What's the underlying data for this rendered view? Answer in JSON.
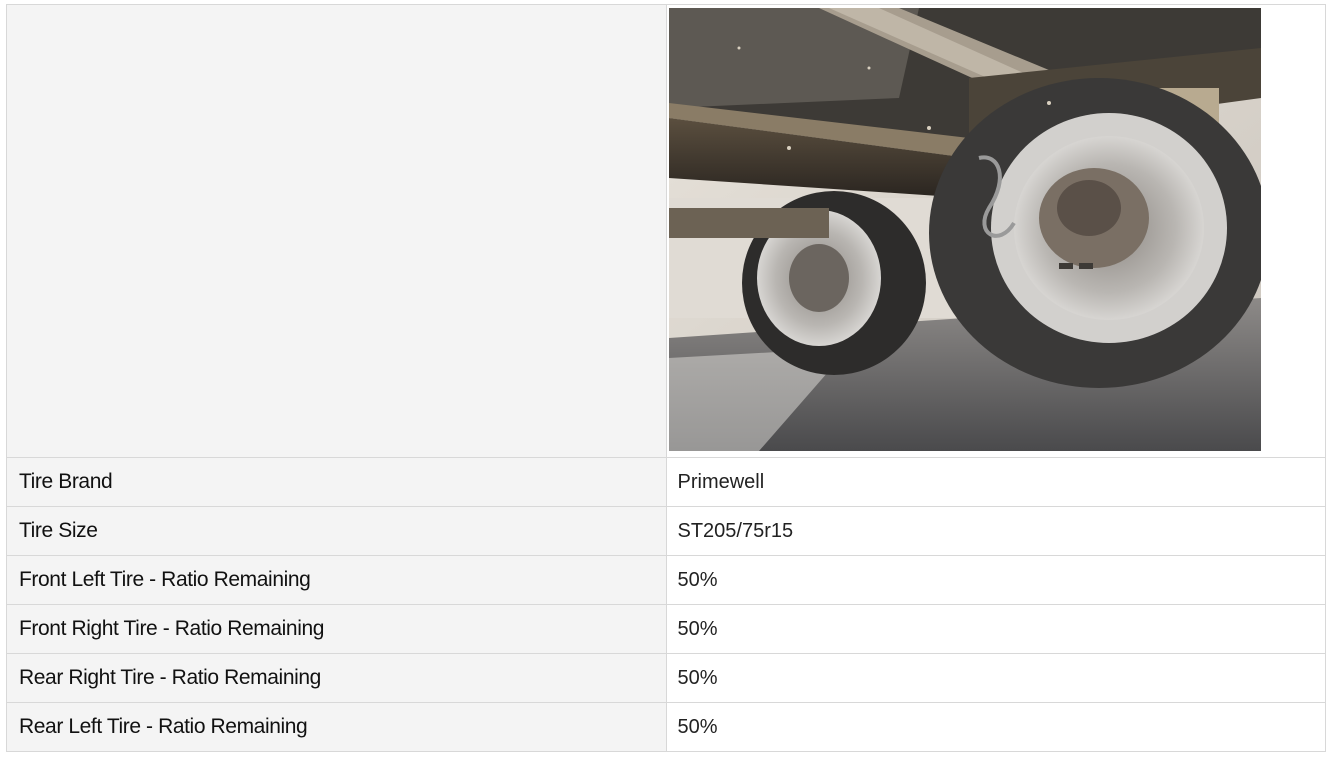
{
  "photo": {
    "icon": "trailer-undercarriage-photo"
  },
  "rows": [
    {
      "label": "Tire Brand",
      "value": "Primewell"
    },
    {
      "label": "Tire Size",
      "value": "ST205/75r15"
    },
    {
      "label": "Front Left Tire - Ratio Remaining",
      "value": "50%"
    },
    {
      "label": "Front Right Tire - Ratio Remaining",
      "value": "50%"
    },
    {
      "label": "Rear Right Tire - Ratio Remaining",
      "value": "50%"
    },
    {
      "label": "Rear Left Tire - Ratio Remaining",
      "value": "50%"
    }
  ],
  "colors": {
    "label_bg": "#f4f4f4",
    "border": "#d8d8d8"
  }
}
